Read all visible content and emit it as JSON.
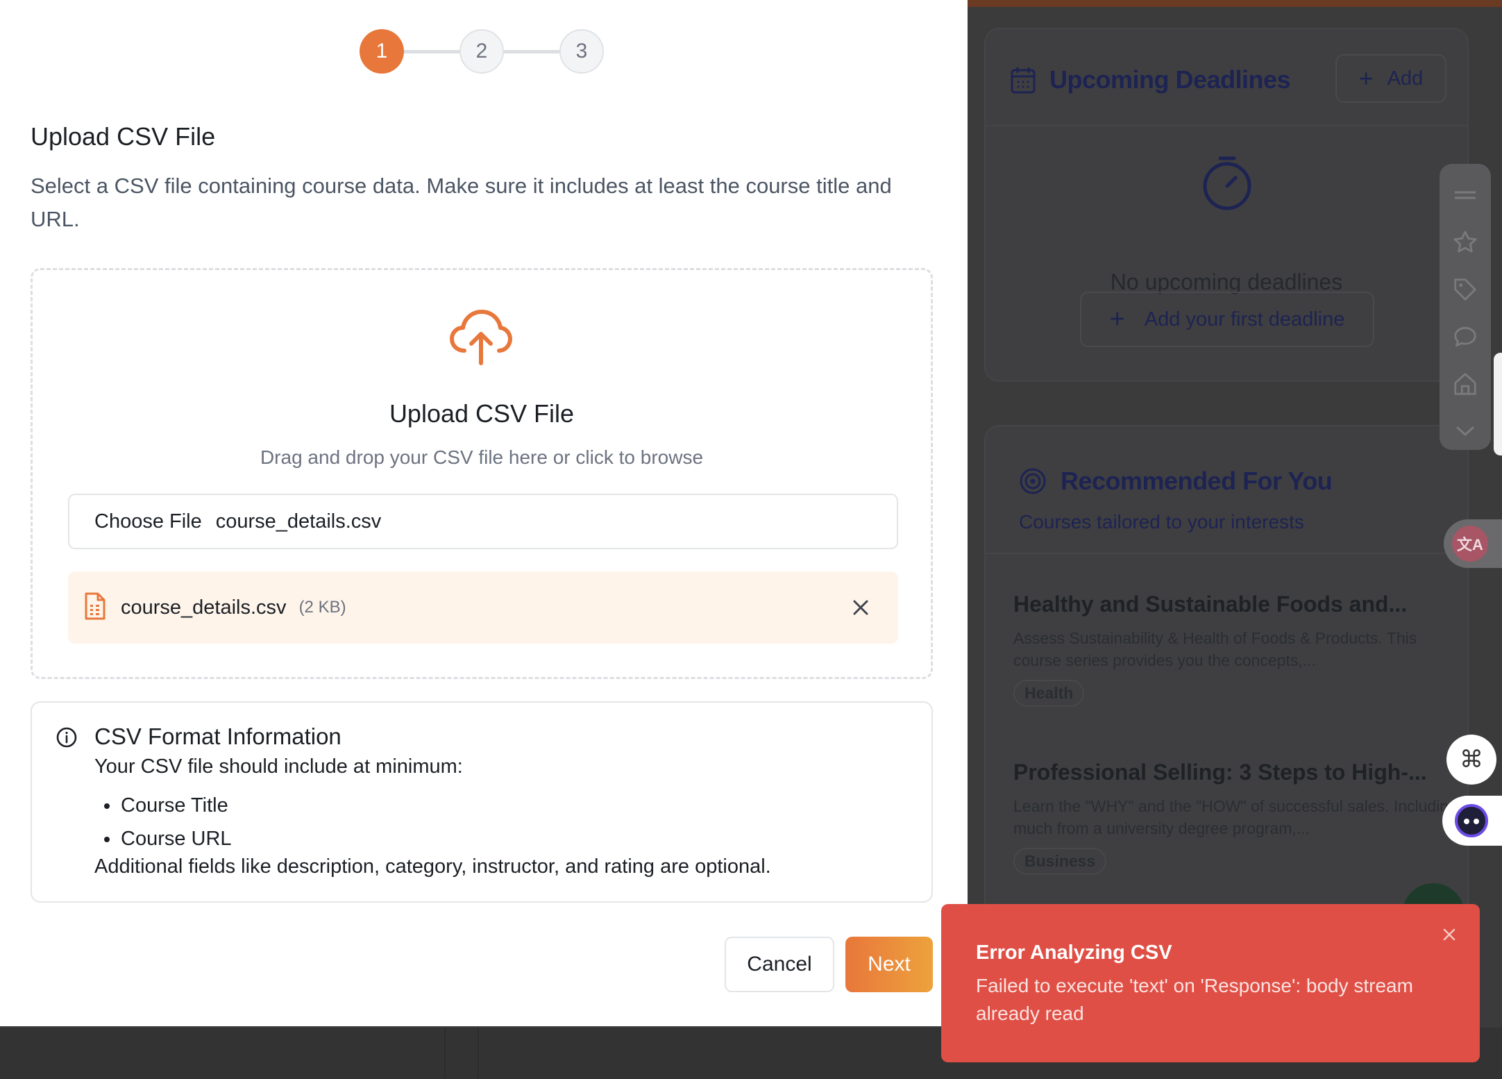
{
  "stepper": {
    "steps": [
      "1",
      "2",
      "3"
    ],
    "current": 1
  },
  "upload": {
    "section_title": "Upload CSV File",
    "section_desc": "Select a CSV file containing course data. Make sure it includes at least the course title and URL.",
    "dropzone_title": "Upload CSV File",
    "dropzone_sub": "Drag and drop your CSV file here or click to browse",
    "choose_label": "Choose File",
    "input_value": "course_details.csv",
    "file_name": "course_details.csv",
    "file_size": "(2 KB)"
  },
  "info": {
    "title": "CSV Format Information",
    "intro": "Your CSV file should include at minimum:",
    "fields": [
      "Course Title",
      "Course URL"
    ],
    "footer": "Additional fields like description, category, instructor, and rating are optional."
  },
  "actions": {
    "cancel": "Cancel",
    "next": "Next"
  },
  "toast": {
    "title": "Error Analyzing CSV",
    "message": "Failed to execute 'text' on 'Response': body stream already read"
  },
  "background": {
    "deadlines": {
      "title": "Upcoming Deadlines",
      "add_label": "Add",
      "empty_text": "No upcoming deadlines",
      "add_first_label": "Add your first deadline"
    },
    "recommended": {
      "title": "Recommended For You",
      "subtitle": "Courses tailored to your interests",
      "courses": [
        {
          "title": "Healthy and Sustainable Foods and...",
          "desc": "Assess Sustainability & Health of Foods & Products. This course series provides you the concepts,...",
          "tag": "Health"
        },
        {
          "title": "Professional Selling: 3 Steps to High-...",
          "desc": "Learn the \"WHY\" and the \"HOW\" of successful sales. Including much from a university degree program,...",
          "tag": "Business"
        }
      ]
    },
    "translate_icon_text": "文A"
  },
  "colors": {
    "accent": "#e8773b",
    "error": "#df4f45",
    "chip_bg": "#fef4ea"
  },
  "icons": {
    "upload": "cloud-upload-icon",
    "file": "file-spreadsheet-icon",
    "remove": "close-icon",
    "info": "info-icon",
    "calendar": "calendar-icon",
    "timer": "timer-icon",
    "target": "target-icon"
  }
}
